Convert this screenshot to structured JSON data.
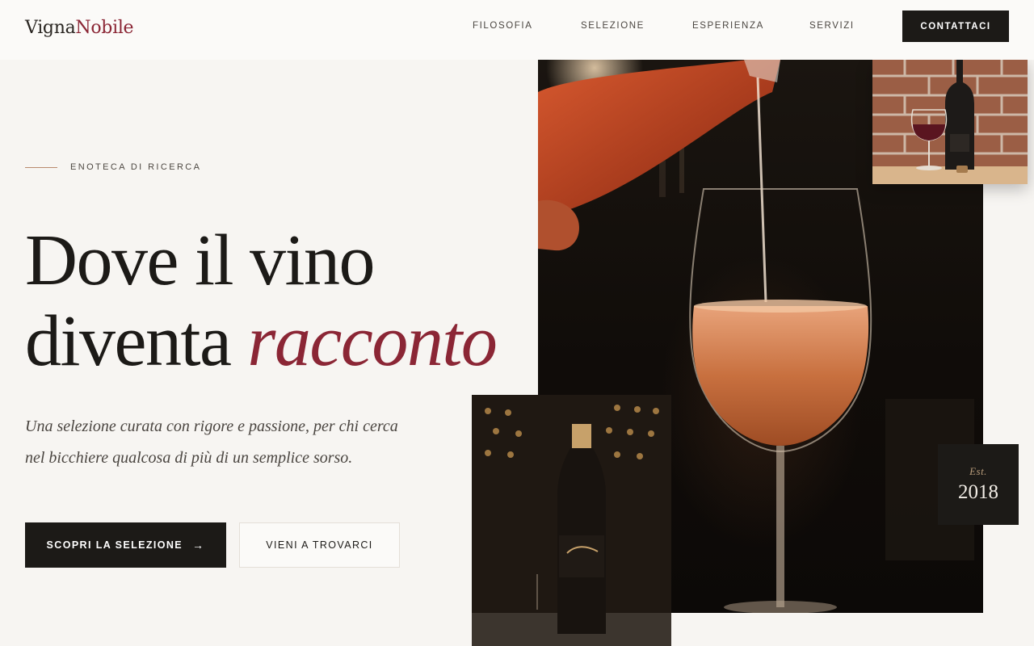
{
  "brand": {
    "name_part1": "Vigna",
    "name_part2": "Nobile"
  },
  "nav": {
    "items": [
      {
        "label": "FILOSOFIA"
      },
      {
        "label": "SELEZIONE"
      },
      {
        "label": "ESPERIENZA"
      },
      {
        "label": "SERVIZI"
      }
    ],
    "cta_label": "CONTATTACI"
  },
  "hero": {
    "eyebrow": "ENOTECA DI RICERCA",
    "headline_line1": "Dove il vino",
    "headline_line2_plain": "diventa ",
    "headline_line2_accent": "racconto",
    "lede": "Una selezione curata con rigore e passione, per chi cerca nel bicchiere qualcosa di più di un semplice sorso.",
    "primary_button": "SCOPRI LA SELEZIONE",
    "secondary_button": "VIENI A TROVARCI"
  },
  "badge": {
    "est_label": "Est.",
    "year": "2018"
  },
  "colors": {
    "accent": "#8b2635",
    "dark": "#1c1a17",
    "background": "#f7f5f2",
    "gold": "#b79b7a"
  },
  "icons": {
    "primary_button_icon": "arrow-right-icon"
  }
}
